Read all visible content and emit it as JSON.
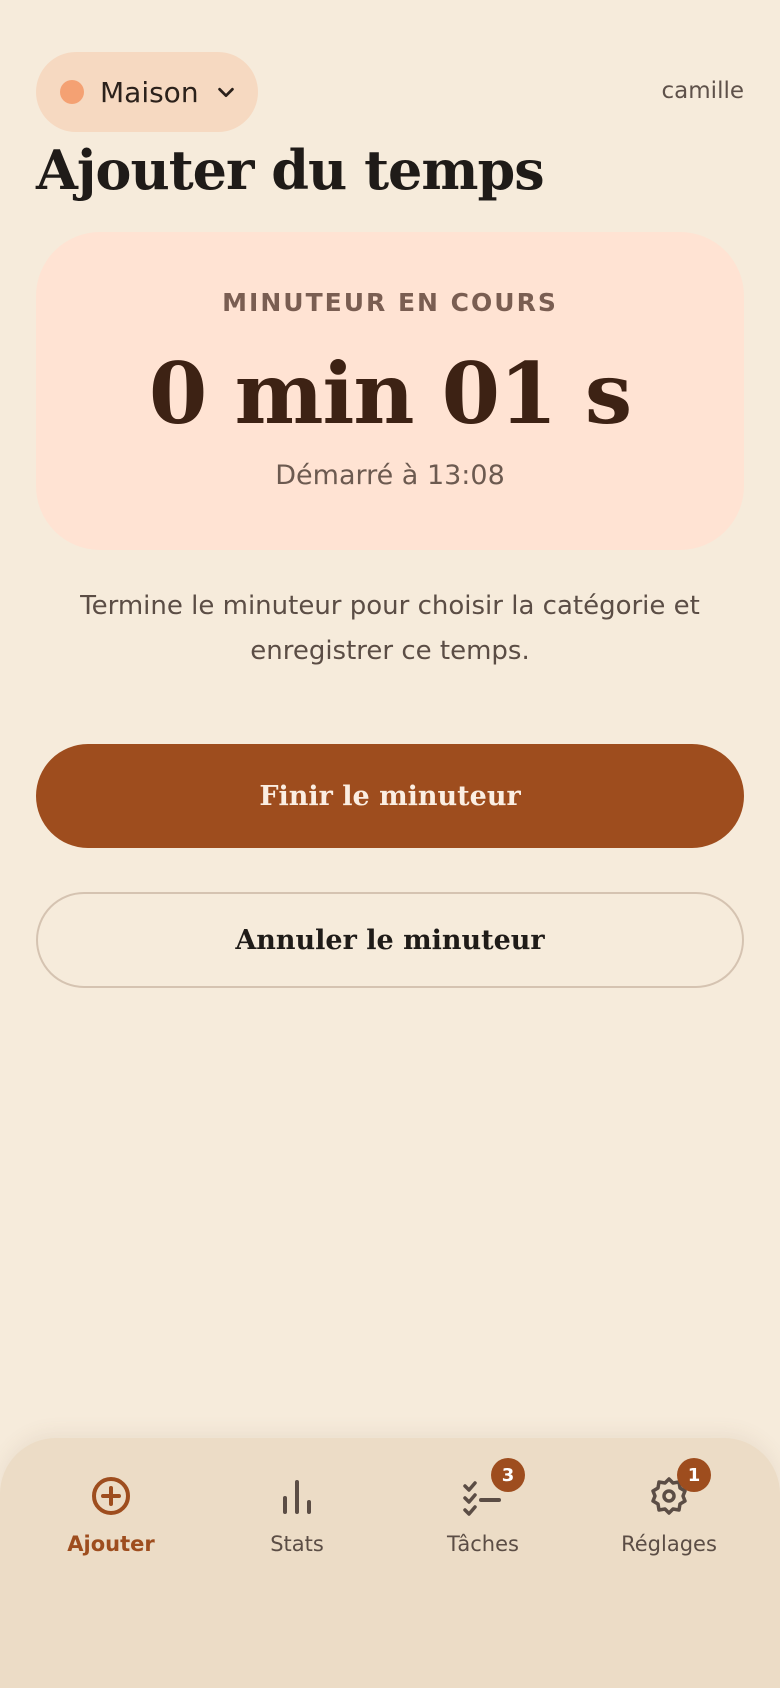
{
  "header": {
    "household": "Maison",
    "household_dot_color": "#f4a173",
    "username": "camille"
  },
  "page_title": "Ajouter du temps",
  "timer": {
    "caption": "MINUTEUR EN COURS",
    "value": "0 min 01 s",
    "started": "Démarré à 13:08"
  },
  "help_text": "Termine le minuteur pour choisir la catégorie et enregistrer ce temps.",
  "actions": {
    "finish": "Finir le minuteur",
    "cancel": "Annuler le minuteur"
  },
  "nav": {
    "items": [
      {
        "label": "Ajouter",
        "icon": "plus-circle-icon",
        "active": true
      },
      {
        "label": "Stats",
        "icon": "bar-chart-icon"
      },
      {
        "label": "Tâches",
        "icon": "checklist-icon",
        "badge": "3"
      },
      {
        "label": "Réglages",
        "icon": "gear-icon",
        "badge": "1"
      }
    ]
  },
  "colors": {
    "background": "#f6ebdb",
    "accent": "#9e4d1e",
    "timer_card": "#ffe3d3"
  }
}
